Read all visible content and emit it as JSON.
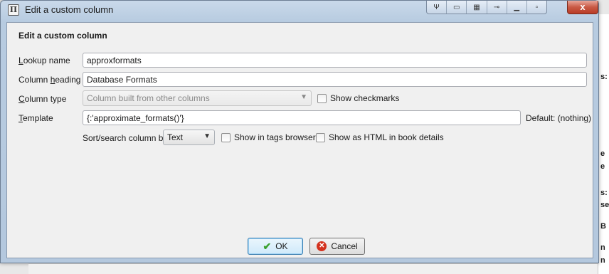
{
  "window": {
    "title": "Edit a custom column",
    "titlebar_tools": [
      "fork",
      "box",
      "grid",
      "tie",
      "minimize",
      "dot"
    ],
    "close_label": "x"
  },
  "form": {
    "heading": "Edit a custom column",
    "lookup_name": {
      "label_pre": "",
      "label_accel": "L",
      "label_post": "ookup name",
      "value": "approxformats"
    },
    "column_heading": {
      "label_pre": "Column ",
      "label_accel": "h",
      "label_post": "eading",
      "value": "Database Formats"
    },
    "column_type": {
      "label_pre": "",
      "label_accel": "C",
      "label_post": "olumn type",
      "value": "Column built from other columns",
      "show_checkmarks": "Show checkmarks"
    },
    "template": {
      "label_pre": "",
      "label_accel": "T",
      "label_post": "emplate",
      "value": "{:'approximate_formats()'}",
      "default_text": "Default: (nothing)"
    },
    "sort_search": {
      "label": "Sort/search column by",
      "value": "Text",
      "show_in_tags": "Show in tags browser",
      "show_as_html": "Show as HTML in book details"
    }
  },
  "buttons": {
    "ok": "OK",
    "cancel": "Cancel"
  },
  "background": {
    "right_fragments": [
      "s:",
      "e",
      "e",
      "s:",
      "se",
      "B",
      "n",
      "n"
    ]
  }
}
